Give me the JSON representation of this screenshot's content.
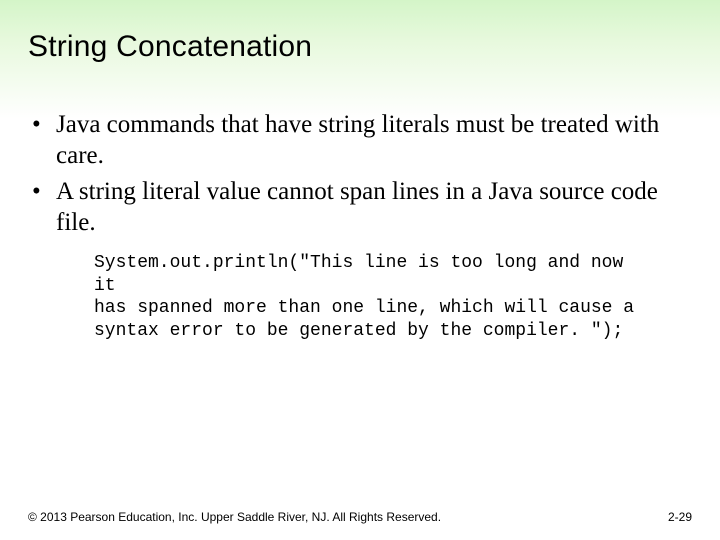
{
  "title": "String Concatenation",
  "bullets": [
    "Java commands that have string literals must be treated with care.",
    "A string literal value cannot span lines in a Java source code file."
  ],
  "code": "System.out.println(\"This line is too long and now it\nhas spanned more than one line, which will cause a\nsyntax error to be generated by the compiler. \");",
  "footer": {
    "copyright": "© 2013 Pearson Education, Inc. Upper Saddle River, NJ. All Rights Reserved.",
    "page": "2-29"
  }
}
